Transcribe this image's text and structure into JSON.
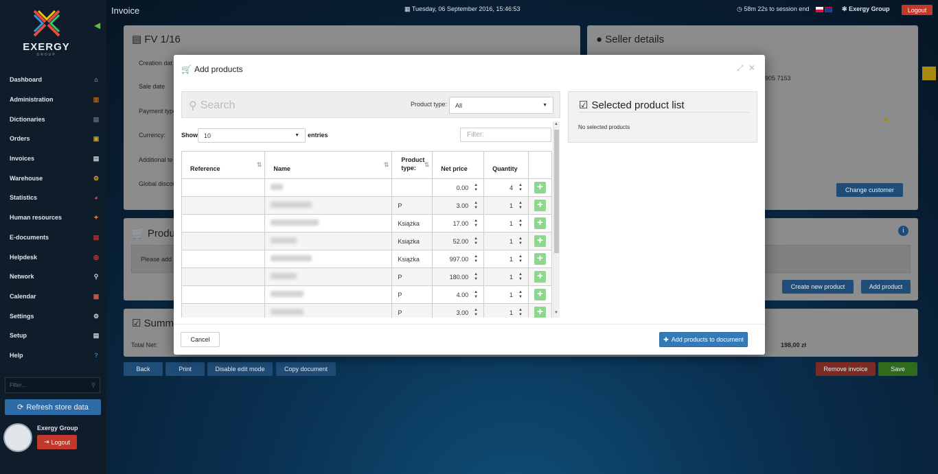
{
  "app": {
    "brand": "EXERGY",
    "brand_sub": "GROUP",
    "page_title": "Invoice",
    "datetime": "Tuesday, 06 September 2016, 15:46:53",
    "session": "58m 22s to session end",
    "company": "Exergy Group",
    "logout": "Logout"
  },
  "sidebar": {
    "items": [
      {
        "label": "Dashboard",
        "icon": "home-icon"
      },
      {
        "label": "Administration",
        "icon": "books-icon"
      },
      {
        "label": "Dictionaries",
        "icon": "book-icon"
      },
      {
        "label": "Orders",
        "icon": "box-icon"
      },
      {
        "label": "Invoices",
        "icon": "document-icon"
      },
      {
        "label": "Warehouse",
        "icon": "forklift-icon"
      },
      {
        "label": "Statistics",
        "icon": "pie-chart-icon"
      },
      {
        "label": "Human resources",
        "icon": "person-icon"
      },
      {
        "label": "E-documents",
        "icon": "pdf-icon"
      },
      {
        "label": "Helpdesk",
        "icon": "lifebuoy-icon"
      },
      {
        "label": "Network",
        "icon": "network-icon"
      },
      {
        "label": "Calendar",
        "icon": "calendar-icon"
      },
      {
        "label": "Settings",
        "icon": "gear-icon"
      },
      {
        "label": "Setup",
        "icon": "setup-icon"
      },
      {
        "label": "Help",
        "icon": "help-icon"
      }
    ],
    "filter_placeholder": "Filter...",
    "refresh": "Refresh store data",
    "user": "Exergy Group",
    "logout": "Logout"
  },
  "background": {
    "doc_title": "FV 1/16",
    "labels": [
      "Creation dat",
      "Sale date",
      "Payment type",
      "Currency:",
      "Additional te",
      "Global discou"
    ],
    "seller_title": "Seller details",
    "seller_phone": "905 7153",
    "change_customer": "Change customer",
    "products_title": "Produc",
    "products_hint": "Please add",
    "create_new_product": "Create new product",
    "add_product": "Add product",
    "summary_title": "Summ",
    "total_net_label": "Total Net:",
    "total_value": "198,00 zł",
    "back": "Back",
    "print": "Print",
    "disable_edit": "Disable edit mode",
    "copy_document": "Copy document",
    "remove_invoice": "Remove invoice",
    "save": "Save"
  },
  "modal": {
    "title": "Add products",
    "search_placeholder": "Search",
    "product_type_label": "Product type:",
    "product_type_value": "All",
    "show_label": "Show",
    "entries_value": "10",
    "entries_label": "entries",
    "filter_placeholder": "Filter:",
    "columns": [
      "Reference",
      "Name",
      "Product type:",
      "Net price",
      "Quantity"
    ],
    "rows": [
      {
        "type": "",
        "price": "0.00",
        "qty": "4"
      },
      {
        "type": "P",
        "price": "3.00",
        "qty": "1"
      },
      {
        "type": "Książka",
        "price": "17.00",
        "qty": "1"
      },
      {
        "type": "Książka",
        "price": "52.00",
        "qty": "1"
      },
      {
        "type": "Książka",
        "price": "997.00",
        "qty": "1"
      },
      {
        "type": "P",
        "price": "180.00",
        "qty": "1"
      },
      {
        "type": "P",
        "price": "4.00",
        "qty": "1"
      },
      {
        "type": "P",
        "price": "3.00",
        "qty": "1"
      }
    ],
    "selected_title": "Selected product list",
    "selected_empty": "No selected products",
    "cancel": "Cancel",
    "add_to_document": "Add products to document"
  }
}
